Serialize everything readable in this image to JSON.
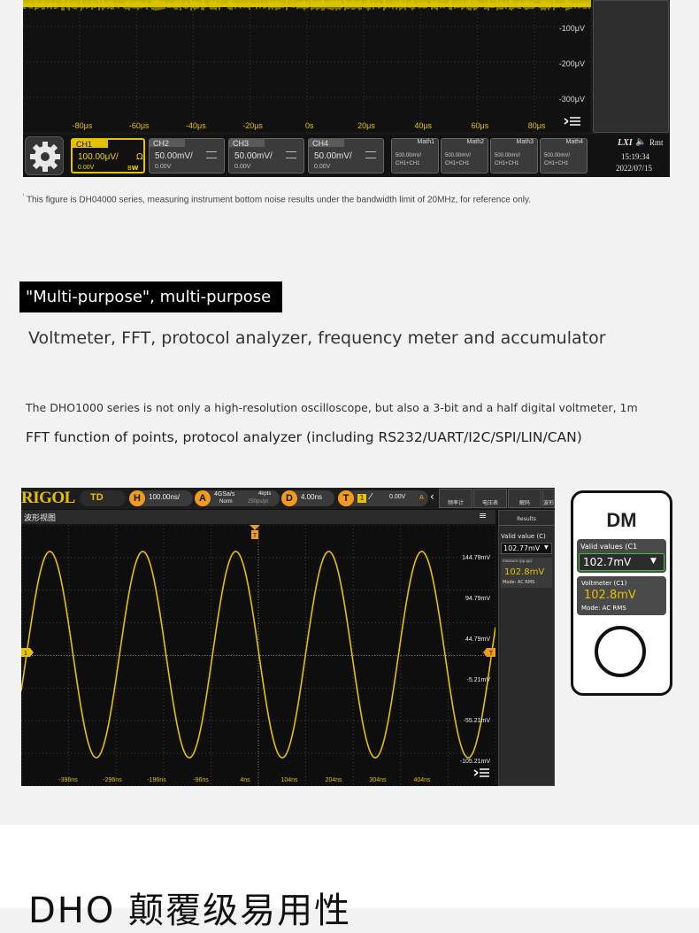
{
  "scope1": {
    "y_labels": [
      "-100μV",
      "-200μV",
      "-300μV"
    ],
    "x_labels": [
      "-80μs",
      "-60μs",
      "-40μs",
      "-20μs",
      "0s",
      "20μs",
      "40μs",
      "60μs",
      "80μs"
    ],
    "channels": [
      {
        "name": "CH1",
        "value": "100.00μV/",
        "offset": "0.00V",
        "coupling": "Ω",
        "bw": "B𝗪",
        "active": true
      },
      {
        "name": "CH2",
        "value": "50.00mV/",
        "offset": "0.00V"
      },
      {
        "name": "CH3",
        "value": "50.00mV/",
        "offset": "0.00V"
      },
      {
        "name": "CH4",
        "value": "50.00mV/",
        "offset": "0.00V"
      }
    ],
    "math": [
      {
        "name": "Math1",
        "line1": "500.00mV/",
        "line2": "CH1+CH1"
      },
      {
        "name": "Math2",
        "line1": "500.00mV/",
        "line2": "CH1+CH1"
      },
      {
        "name": "Math3",
        "line1": "500.00mV/",
        "line2": "CH1+CH1"
      },
      {
        "name": "Math4",
        "line1": "500.00mV/",
        "line2": "CH1+CH1"
      }
    ],
    "status": {
      "lxi": "LXI",
      "rmt": "Rmt",
      "time": "15:19:34",
      "date": "2022/07/15"
    }
  },
  "caption": "This figure is DH04000 series, measuring instrument bottom noise results under the bandwidth limit of 20MHz, for reference only.",
  "section": {
    "title": "\"Multi-purpose\", multi-purpose",
    "subtitle": "Voltmeter, FFT, protocol analyzer, frequency meter and accumulator",
    "desc1": "The DHO1000 series is not only a high-resolution oscilloscope, but also a 3-bit and a half digital voltmeter, 1m",
    "desc2": "FFT function of points, protocol analyzer (including RS232/UART/I2C/SPI/LIN/CAN)"
  },
  "scope2": {
    "brand": "RIGOL",
    "mode": "TD",
    "timebase": "100.00ns/",
    "sample_rate": "4GSa/s",
    "points": "4kpts",
    "acq_mode": "Norm",
    "acq_sub": "250ps/pt",
    "delay": "4.00ns",
    "trig_level": "0.00V",
    "tools": [
      "频率计",
      "电压表",
      "解码",
      "波形"
    ],
    "window_title": "波形视图",
    "y_labels": [
      "144.79mV",
      "94.79mV",
      "44.79mV",
      "-5.21mV",
      "-55.21mV",
      "-105.21mV",
      "-155.21mV"
    ],
    "x_labels": [
      "-396ns",
      "-296ns",
      "-196ns",
      "-96ns",
      "4ns",
      "104ns",
      "204ns",
      "304ns",
      "404ns"
    ],
    "results": {
      "title": "Results",
      "valid_label": "Valid value (C)",
      "valid_value": "102.77mV",
      "measure_label": "measure (pp.pp)",
      "measure_value": "102.8mV",
      "mode": "Mode:  AC RMS"
    }
  },
  "dm": {
    "title": "DM",
    "valid_label": "Valid values (C1",
    "valid_value": "102.7mV",
    "volt_label": "Voltmeter (C1)",
    "volt_value": "102.8mV",
    "mode": "Mode:  AC RMS"
  },
  "bottom": {
    "title": "DHO   颠覆级易用性"
  },
  "colors": {
    "ch1": "#e5c100",
    "trigger": "#f09a20",
    "timebase": "#e5c100",
    "dm_panel": "#4a4a4a",
    "dm_green": "#3ec23e"
  }
}
